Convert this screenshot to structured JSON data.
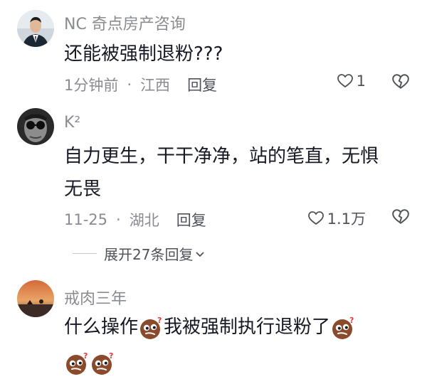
{
  "comments": [
    {
      "username": "NC 奇点房产咨询",
      "text": "还能被强制退粉???",
      "time": "1分钟前",
      "location": "江西",
      "reply_label": "回复",
      "like_count": "1",
      "avatar_icon": "avatar-man-suit"
    },
    {
      "username": "K²",
      "text_line1": "自力更生，干干净净，站的笔直，无惧",
      "text_line2": "无畏",
      "time": "11-25",
      "location": "湖北",
      "reply_label": "回复",
      "like_count": "1.1万",
      "avatar_icon": "avatar-sunglasses-bw",
      "expand_label": "展开27条回复"
    },
    {
      "username": "戒肉三年",
      "text_part1": "什么操作",
      "text_part2": "我被强制执行退粉了",
      "avatar_icon": "avatar-sunset-landscape",
      "emoji_icon": "puzzled-face-emoji"
    }
  ],
  "colors": {
    "primary_text": "#161823",
    "secondary_text": "#8a8b91",
    "reply_text": "#505259"
  }
}
